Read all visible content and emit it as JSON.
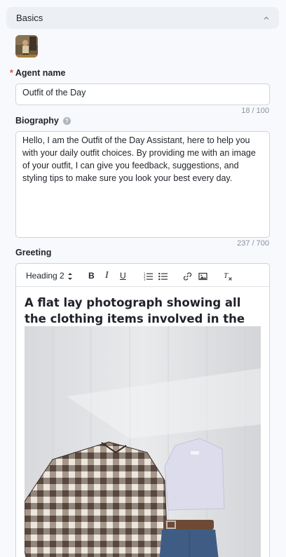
{
  "section": {
    "title": "Basics"
  },
  "agent_name": {
    "label": "Agent name",
    "value": "Outfit of the Day",
    "counter": "18 / 100"
  },
  "biography": {
    "label": "Biography",
    "value": "Hello, I am the Outfit of the Day Assistant, here to help you with your daily outfit choices. By providing me with an image of your outfit, I can give you feedback, suggestions, and styling tips to make sure you look your best every day.",
    "counter": "237 / 700"
  },
  "greeting": {
    "label": "Greeting",
    "toolbar": {
      "heading_select": "Heading 2",
      "bold": "B",
      "italic": "I",
      "underline": "U"
    },
    "content_heading": "A flat lay photograph showing all the clothing items involved in the photo."
  },
  "colors": {
    "accent_required": "#e5484d",
    "border": "#cfd4dc",
    "header_bg": "#eceff3"
  }
}
